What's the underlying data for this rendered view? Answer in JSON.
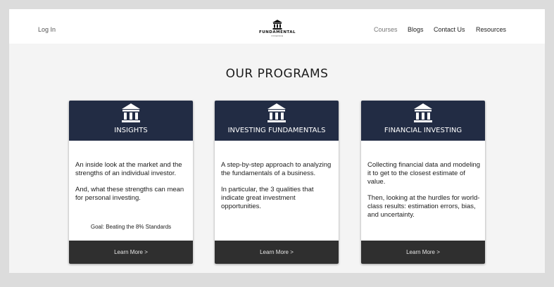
{
  "nav": {
    "login": "Log In",
    "links": [
      "Courses",
      "Blogs",
      "Contact Us",
      "Resources"
    ]
  },
  "logo": {
    "word": "FUNDAMENTAL",
    "sub": "FINANCE",
    "icon": "pillar-building-icon"
  },
  "page": {
    "title": "OUR PROGRAMS"
  },
  "cards": [
    {
      "title": "INSIGHTS",
      "icon": "pillar-building-icon",
      "paragraphs": [
        "An inside look at the market and the strengths of an individual investor.",
        "And, what these strengths can mean for personal investing."
      ],
      "goal": "Goal: Beating the 8% Standards",
      "cta": "Learn More >"
    },
    {
      "title": "INVESTING FUNDAMENTALS",
      "icon": "pillar-building-icon",
      "paragraphs": [
        "A step-by-step approach to analyzing the fundamentals of a business.",
        "In particular, the 3 qualities that indicate great investment opportunities."
      ],
      "cta": "Learn More >"
    },
    {
      "title": "FINANCIAL INVESTING",
      "icon": "pillar-building-icon",
      "paragraphs": [
        "Collecting financial data and modeling it to get to the closest estimate of value.",
        "Then, looking at the hurdles for world-class results: estimation errors, bias, and uncertainty."
      ],
      "cta": "Learn More >"
    }
  ],
  "colors": {
    "card_header": "#222c44",
    "card_footer": "#2f2f2f",
    "page_bg": "#f4f4f4",
    "outer_bg": "#dcdcdc"
  }
}
